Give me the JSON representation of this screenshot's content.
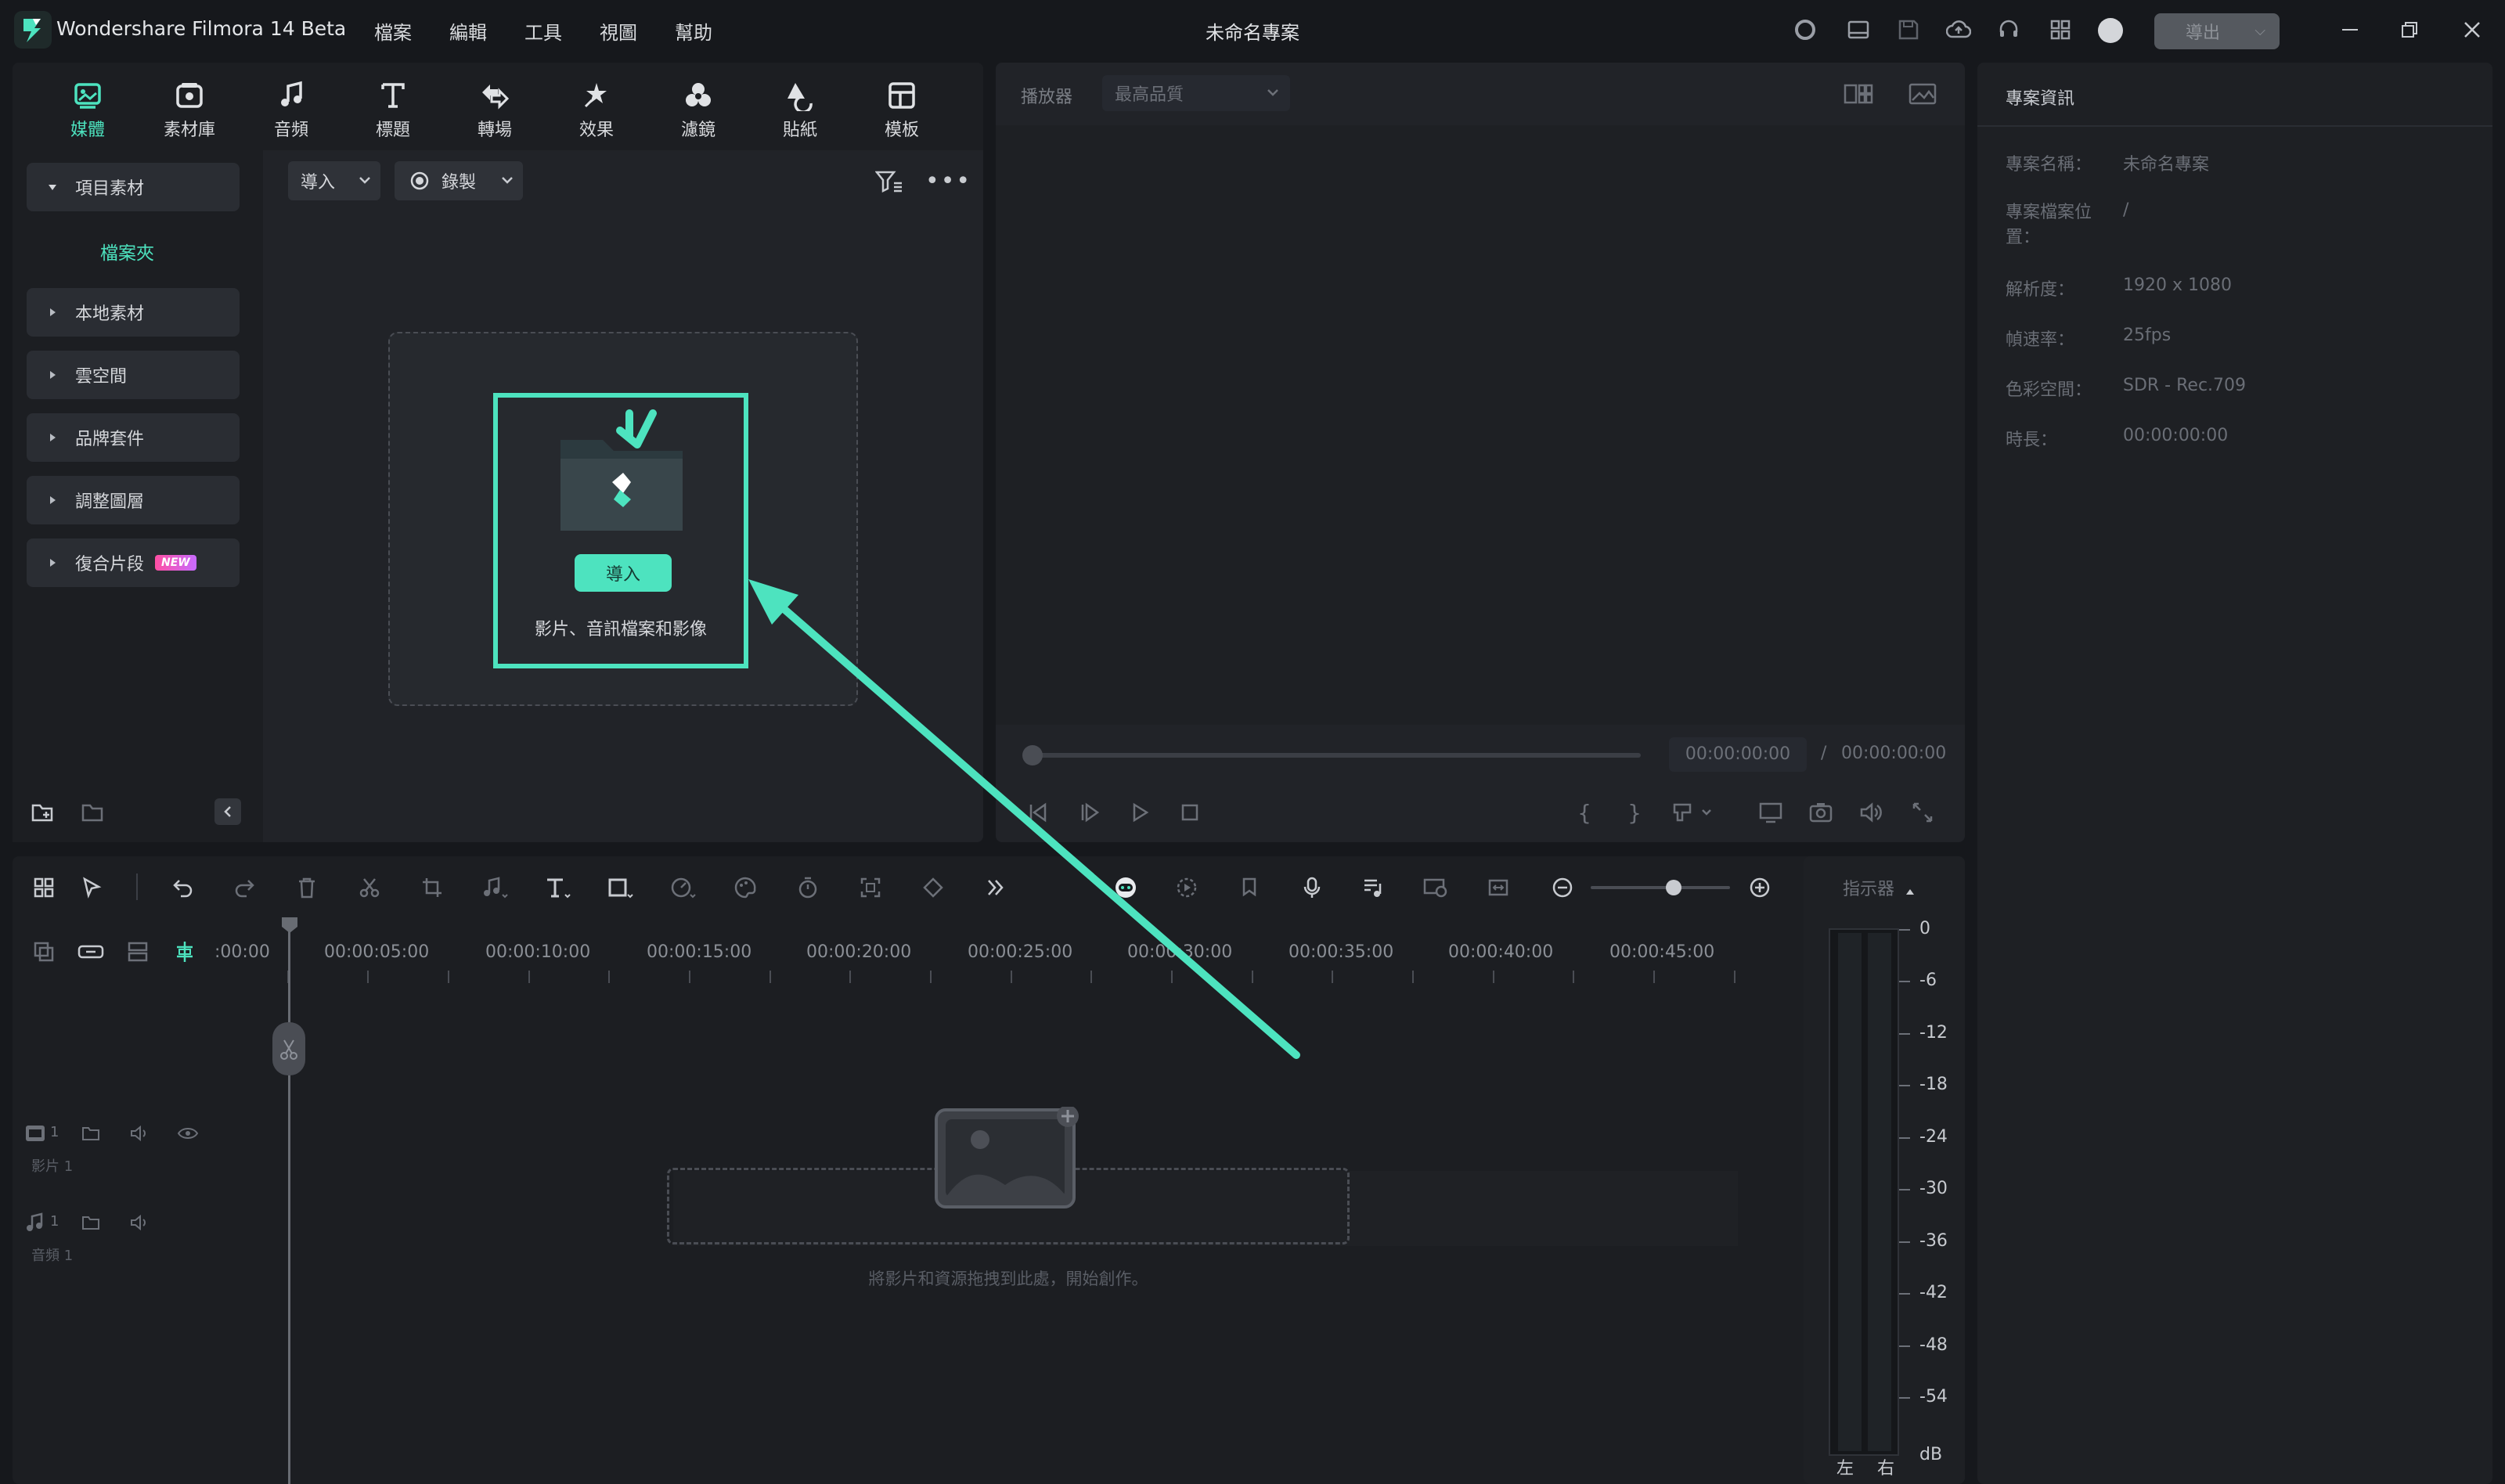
{
  "app": {
    "title": "Wondershare Filmora 14 Beta",
    "project_title": "未命名專案",
    "export_label": "導出"
  },
  "menu": [
    "檔案",
    "編輯",
    "工具",
    "視圖",
    "幫助"
  ],
  "tabs": [
    {
      "label": "媒體",
      "icon": "media-icon",
      "active": true
    },
    {
      "label": "素材庫",
      "icon": "stock-library-icon"
    },
    {
      "label": "音頻",
      "icon": "audio-icon"
    },
    {
      "label": "標題",
      "icon": "title-icon"
    },
    {
      "label": "轉場",
      "icon": "transition-icon"
    },
    {
      "label": "效果",
      "icon": "effects-icon"
    },
    {
      "label": "濾鏡",
      "icon": "filters-icon"
    },
    {
      "label": "貼紙",
      "icon": "stickers-icon"
    },
    {
      "label": "模板",
      "icon": "templates-icon"
    }
  ],
  "sidebar": {
    "project_media": "項目素材",
    "folder": "檔案夾",
    "items": [
      "本地素材",
      "雲空間",
      "品牌套件",
      "調整圖層",
      "復合片段"
    ],
    "new_badge": "NEW"
  },
  "media_toolbar": {
    "import": "導入",
    "record": "錄製"
  },
  "import_box": {
    "button": "導入",
    "hint": "影片、音訊檔案和影像"
  },
  "player": {
    "label": "播放器",
    "quality": "最高品質",
    "current_time": "00:00:00:00",
    "separator": "/",
    "total_time": "00:00:00:00"
  },
  "project_info": {
    "title": "專案資訊",
    "rows": [
      {
        "label": "專案名稱：",
        "value": "未命名專案"
      },
      {
        "label": "專案檔案位置：",
        "value": "/"
      },
      {
        "label": "解析度：",
        "value": "1920 x 1080"
      },
      {
        "label": "幀速率：",
        "value": "25fps"
      },
      {
        "label": "色彩空間：",
        "value": "SDR - Rec.709"
      },
      {
        "label": "時長：",
        "value": "00:00:00:00"
      }
    ]
  },
  "timeline": {
    "ruler": [
      ":00:00",
      "00:00:05:00",
      "00:00:10:00",
      "00:00:15:00",
      "00:00:20:00",
      "00:00:25:00",
      "00:00:30:00",
      "00:00:35:00",
      "00:00:40:00",
      "00:00:45:00"
    ],
    "video_track": "影片 1",
    "audio_track": "音頻 1",
    "track_number": "1",
    "drop_hint": "將影片和資源拖拽到此處，開始創作。",
    "zoom_level": 0.6
  },
  "meter": {
    "title": "指示器",
    "scale": [
      "0",
      "-6",
      "-12",
      "-18",
      "-24",
      "-30",
      "-36",
      "-42",
      "-48",
      "-54",
      "dB"
    ],
    "left": "左",
    "right": "右"
  },
  "colors": {
    "accent": "#4de3bf",
    "bg": "#16181c",
    "panel": "#212328"
  }
}
